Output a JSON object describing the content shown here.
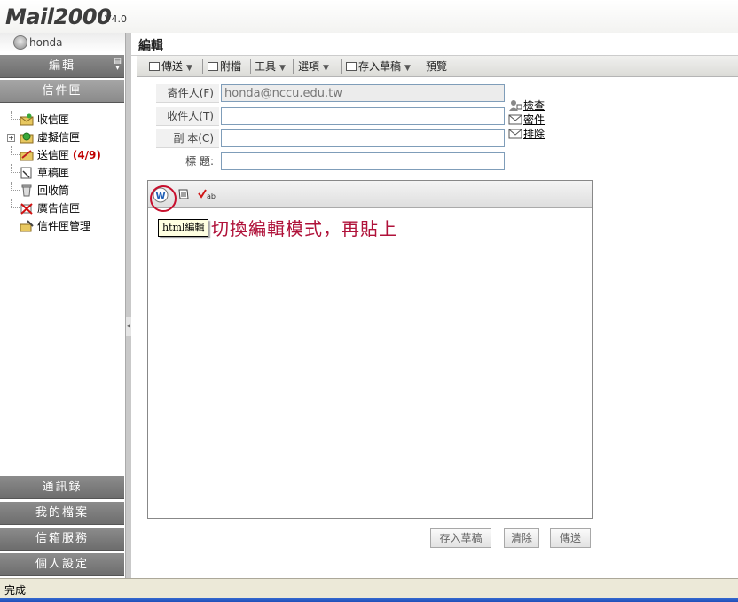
{
  "app": {
    "logo_text": "Mail2000",
    "version": "V4.0"
  },
  "user": {
    "name": "honda"
  },
  "sidebar": {
    "top_buttons": {
      "compose": "編輯",
      "mailboxes": "信件匣"
    },
    "folders": [
      {
        "label": "收信匣",
        "count": ""
      },
      {
        "label": "虛擬信匣",
        "count": ""
      },
      {
        "label": "送信匣",
        "count": "(4/9)"
      },
      {
        "label": "草稿匣",
        "count": ""
      },
      {
        "label": "回收筒",
        "count": ""
      },
      {
        "label": "廣告信匣",
        "count": ""
      },
      {
        "label": "信件匣管理",
        "count": ""
      }
    ],
    "bottom_buttons": {
      "address_book": "通訊錄",
      "my_files": "我的檔案",
      "mailbox_service": "信箱服務",
      "personal_settings": "個人設定"
    }
  },
  "main": {
    "title": "編輯",
    "toolbar": {
      "send": "傳送",
      "attach": "附檔",
      "tools": "工具",
      "options": "選項",
      "save_draft": "存入草稿",
      "preview": "預覽"
    },
    "form": {
      "from_label": "寄件人(F)",
      "from_value": "honda@nccu.edu.tw",
      "to_label": "收件人(T)",
      "to_value": "",
      "cc_label": "副 本(C)",
      "cc_value": "",
      "subject_label": "標 題:",
      "subject_value": ""
    },
    "side_links": {
      "check": "檢查",
      "bcc": "密件",
      "exclude": "排除"
    },
    "editor": {
      "tooltip": "html編輯",
      "annotation": "切換編輯模式，再貼上"
    },
    "buttons": {
      "save_draft": "存入草稿",
      "clear": "清除",
      "send": "傳送"
    }
  },
  "status": {
    "text": "完成"
  },
  "colors": {
    "sidebar_button": "#7c7c7c",
    "annotation": "#b0123a",
    "highlight": "#c8102e",
    "count": "#c00000"
  }
}
